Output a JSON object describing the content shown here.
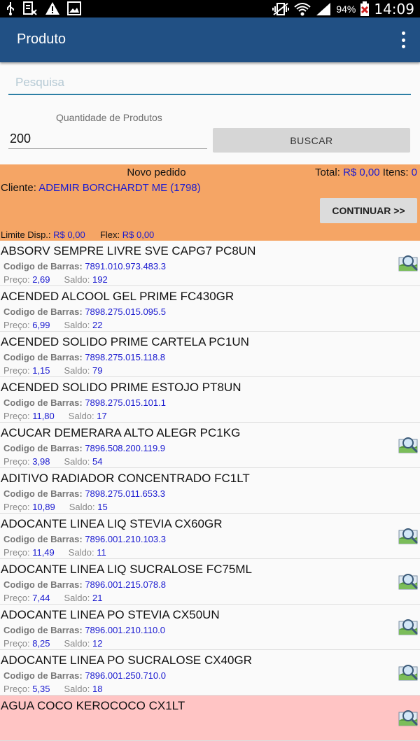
{
  "status_bar": {
    "battery": "94%",
    "time": "14:09"
  },
  "header": {
    "title": "Produto"
  },
  "search": {
    "placeholder": "Pesquisa"
  },
  "quantity": {
    "label": "Quantidade de Produtos",
    "value": "200"
  },
  "buscar_label": "BUSCAR",
  "order": {
    "title": "Novo pedido",
    "total_label": "Total:",
    "total_value": "R$ 0,00",
    "items_label": "Itens:",
    "items_value": "0",
    "client_label": "Cliente:",
    "client_value": "ADEMIR BORCHARDT ME (1798)",
    "continue_label": "CONTINUAR >>",
    "limit_label": "Limite Disp.:",
    "limit_value": "R$ 0,00",
    "flex_label": "Flex:",
    "flex_value": "R$ 0,00"
  },
  "labels": {
    "barcode": "Codigo de Barras:",
    "price": "Preço:",
    "stock": "Saldo:"
  },
  "products": [
    {
      "name": "ABSORV SEMPRE LIVRE SVE CAPG7 PC8UN",
      "barcode": "7891.010.973.483.3",
      "price": "2,69",
      "stock": "192",
      "has_image": true
    },
    {
      "name": "ACENDED ALCOOL GEL PRIME FC430GR",
      "barcode": "7898.275.015.095.5",
      "price": "6,99",
      "stock": "22",
      "has_image": false
    },
    {
      "name": "ACENDED SOLIDO PRIME CARTELA PC1UN",
      "barcode": "7898.275.015.118.8",
      "price": "1,15",
      "stock": "79",
      "has_image": false
    },
    {
      "name": "ACENDED SOLIDO PRIME ESTOJO PT8UN",
      "barcode": "7898.275.015.101.1",
      "price": "11,80",
      "stock": "17",
      "has_image": false
    },
    {
      "name": "ACUCAR DEMERARA ALTO ALEGR PC1KG",
      "barcode": "7896.508.200.119.9",
      "price": "3,98",
      "stock": "54",
      "has_image": true
    },
    {
      "name": "ADITIVO RADIADOR CONCENTRADO FC1LT",
      "barcode": "7898.275.011.653.3",
      "price": "10,89",
      "stock": "15",
      "has_image": false
    },
    {
      "name": "ADOCANTE LINEA LIQ STEVIA CX60GR",
      "barcode": "7896.001.210.103.3",
      "price": "11,49",
      "stock": "11",
      "has_image": true
    },
    {
      "name": "ADOCANTE LINEA LIQ SUCRALOSE FC75ML",
      "barcode": "7896.001.215.078.8",
      "price": "7,44",
      "stock": "21",
      "has_image": true
    },
    {
      "name": "ADOCANTE LINEA PO STEVIA CX50UN",
      "barcode": "7896.001.210.110.0",
      "price": "8,25",
      "stock": "12",
      "has_image": true
    },
    {
      "name": "ADOCANTE LINEA PO SUCRALOSE CX40GR",
      "barcode": "7896.001.250.710.0",
      "price": "5,35",
      "stock": "18",
      "has_image": true
    },
    {
      "name": "AGUA COCO KEROCOCO CX1LT",
      "barcode": "",
      "price": "",
      "stock": "",
      "has_image": true,
      "highlight": true
    }
  ],
  "colors": {
    "toolbar": "#215084",
    "order_panel": "#f5a565",
    "value_blue": "#1a1ad0",
    "highlight_row": "#ffc4c4"
  }
}
